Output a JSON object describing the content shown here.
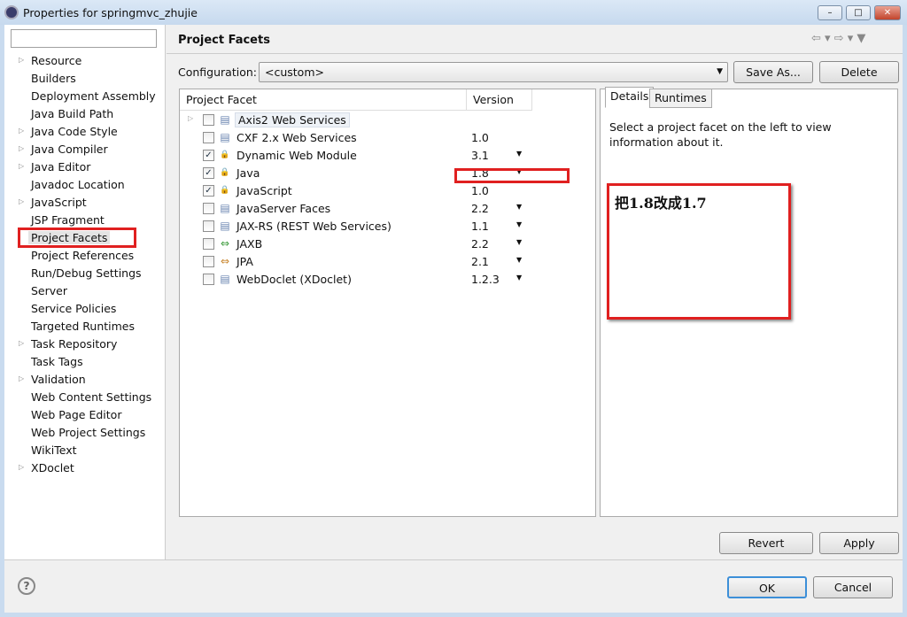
{
  "window": {
    "title": "Properties for springmvc_zhujie",
    "minimize": "–",
    "maximize": "□",
    "close": "✕"
  },
  "sidebar": {
    "filter_value": "",
    "items": [
      {
        "label": "Resource",
        "expandable": true
      },
      {
        "label": "Builders"
      },
      {
        "label": "Deployment Assembly"
      },
      {
        "label": "Java Build Path"
      },
      {
        "label": "Java Code Style",
        "expandable": true
      },
      {
        "label": "Java Compiler",
        "expandable": true
      },
      {
        "label": "Java Editor",
        "expandable": true
      },
      {
        "label": "Javadoc Location"
      },
      {
        "label": "JavaScript",
        "expandable": true
      },
      {
        "label": "JSP Fragment"
      },
      {
        "label": "Project Facets",
        "selected": true
      },
      {
        "label": "Project References"
      },
      {
        "label": "Run/Debug Settings"
      },
      {
        "label": "Server"
      },
      {
        "label": "Service Policies"
      },
      {
        "label": "Targeted Runtimes"
      },
      {
        "label": "Task Repository",
        "expandable": true
      },
      {
        "label": "Task Tags"
      },
      {
        "label": "Validation",
        "expandable": true
      },
      {
        "label": "Web Content Settings"
      },
      {
        "label": "Web Page Editor"
      },
      {
        "label": "Web Project Settings"
      },
      {
        "label": "WikiText"
      },
      {
        "label": "XDoclet",
        "expandable": true
      }
    ]
  },
  "main": {
    "title": "Project Facets",
    "nav": "⇦ ▾  ⇨ ▾  ▼",
    "configuration_label": "Configuration:",
    "configuration_value": "<custom>",
    "save_as": "Save As...",
    "delete": "Delete",
    "columns": [
      "Project Facet",
      "Version"
    ],
    "facets": [
      {
        "name": "Axis2 Web Services",
        "version": "",
        "checked": false,
        "icon": "page",
        "expandable": true,
        "dropdown": false
      },
      {
        "name": "CXF 2.x Web Services",
        "version": "1.0",
        "checked": false,
        "icon": "page",
        "dropdown": false
      },
      {
        "name": "Dynamic Web Module",
        "version": "3.1",
        "checked": true,
        "icon": "locked-web",
        "dropdown": true
      },
      {
        "name": "Java",
        "version": "1.8",
        "checked": true,
        "icon": "locked-java",
        "dropdown": true
      },
      {
        "name": "JavaScript",
        "version": "1.0",
        "checked": true,
        "icon": "locked-page",
        "dropdown": false
      },
      {
        "name": "JavaServer Faces",
        "version": "2.2",
        "checked": false,
        "icon": "page",
        "dropdown": true
      },
      {
        "name": "JAX-RS (REST Web Services)",
        "version": "1.1",
        "checked": false,
        "icon": "page",
        "dropdown": true
      },
      {
        "name": "JAXB",
        "version": "2.2",
        "checked": false,
        "icon": "arrows-green",
        "dropdown": true
      },
      {
        "name": "JPA",
        "version": "2.1",
        "checked": false,
        "icon": "arrows-orange",
        "dropdown": true
      },
      {
        "name": "WebDoclet (XDoclet)",
        "version": "1.2.3",
        "checked": false,
        "icon": "page",
        "dropdown": true
      }
    ],
    "tabs": [
      "Details",
      "Runtimes"
    ],
    "details_text": "Select a project facet on the left to view information about it.",
    "annotation": "把1.8改成1.7",
    "revert": "Revert",
    "apply": "Apply"
  },
  "footer": {
    "help": "?",
    "ok": "OK",
    "cancel": "Cancel"
  },
  "colors": {
    "highlight": "#e02020",
    "window": "#c9dbef"
  }
}
